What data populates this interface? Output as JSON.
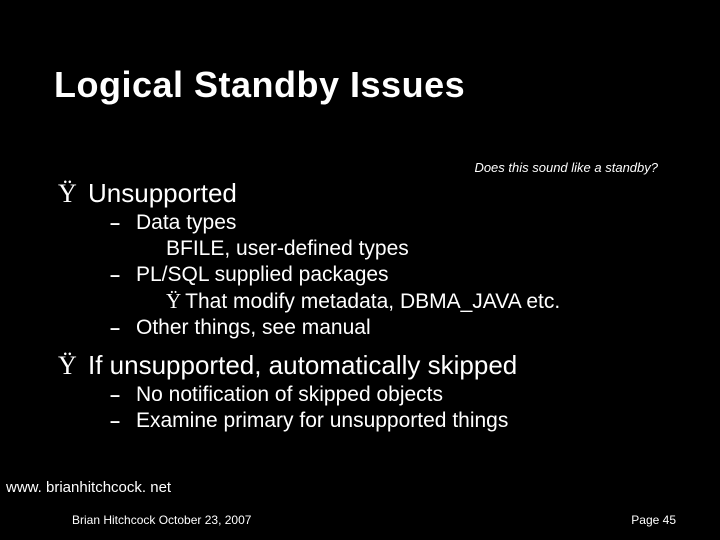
{
  "title": "Logical Standby Issues",
  "tagline": "Does this sound like a standby?",
  "bullets": {
    "b1": {
      "marker": "Ÿ",
      "text": "Unsupported"
    },
    "b1_1": {
      "marker": "–",
      "text": "Data types"
    },
    "b1_1_a": "BFILE, user-defined types",
    "b1_2": {
      "marker": "–",
      "text": "PL/SQL supplied packages"
    },
    "b1_2_a": {
      "marker": "Ÿ",
      "text": "That modify metadata, DBMA_JAVA etc."
    },
    "b1_3": {
      "marker": "–",
      "text": "Other things, see manual"
    },
    "b2": {
      "marker": "Ÿ",
      "text": "If unsupported, automatically skipped"
    },
    "b2_1": {
      "marker": "–",
      "text": "No notification of skipped objects"
    },
    "b2_2": {
      "marker": "–",
      "text": "Examine primary for unsupported things"
    }
  },
  "footer": {
    "link": "www. brianhitchcock. net",
    "author": "Brian Hitchcock  October 23, 2007",
    "page": "Page 45"
  }
}
